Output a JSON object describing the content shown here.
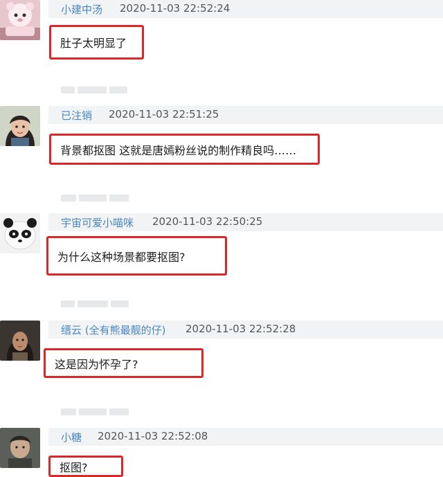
{
  "comments": [
    {
      "username": "小建中汤",
      "timestamp": "2020-11-03 22:52:24",
      "text": "肚子太明显了"
    },
    {
      "username": "已注销",
      "timestamp": "2020-11-03 22:51:25",
      "text": "背景都抠图 这就是唐嫣粉丝说的制作精良吗……"
    },
    {
      "username": "宇宙可爱小喵咪",
      "timestamp": "2020-11-03 22:50:25",
      "text": "为什么这种场景都要抠图?"
    },
    {
      "username": "缙云 (全有熊最靓的仔)",
      "timestamp": "2020-11-03 22:52:28",
      "text": "这是因为怀孕了?"
    },
    {
      "username": "小糖",
      "timestamp": "2020-11-03 22:52:08",
      "text": "抠图?"
    }
  ],
  "colors": {
    "highlight_border": "#d9272a",
    "username": "#4a87c0",
    "header_bg": "#f1f3f5"
  }
}
